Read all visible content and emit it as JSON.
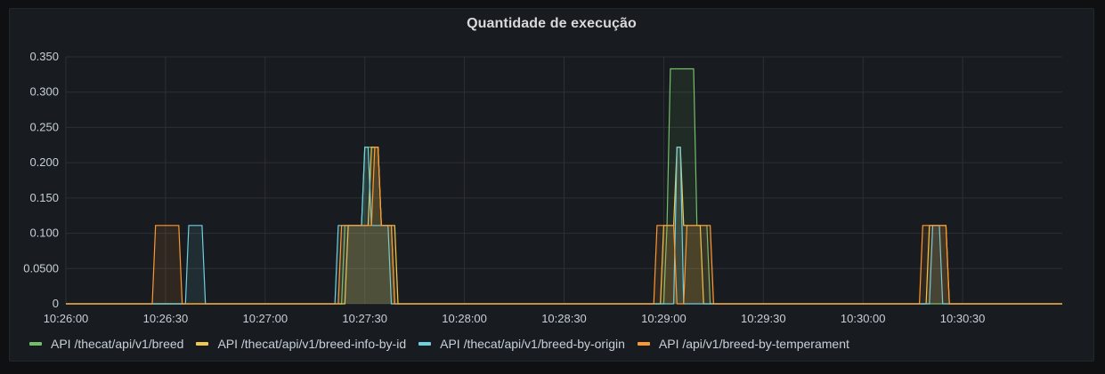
{
  "panel": {
    "title": "Quantidade de execução"
  },
  "chart_data": {
    "type": "area",
    "title": "Quantidade de execução",
    "xlabel": "",
    "ylabel": "",
    "y_ticks": [
      "0",
      "0.0500",
      "0.100",
      "0.150",
      "0.200",
      "0.250",
      "0.300",
      "0.350"
    ],
    "ylim": [
      0,
      0.35
    ],
    "x_ticks": [
      "10:26:00",
      "10:26:30",
      "10:27:00",
      "10:27:30",
      "10:28:00",
      "10:28:30",
      "10:29:00",
      "10:29:30",
      "10:30:00",
      "10:30:30"
    ],
    "xlim": [
      "10:26:00",
      "10:31:00"
    ],
    "grid": true,
    "legend_position": "bottom-left",
    "series": [
      {
        "name": "API /thecat/api/v1/breed",
        "color": "#73bf69",
        "points": [
          [
            "10:26:00",
            0
          ],
          [
            "10:27:23",
            0
          ],
          [
            "10:27:24",
            0.111
          ],
          [
            "10:27:29",
            0.111
          ],
          [
            "10:27:30",
            0.222
          ],
          [
            "10:27:34",
            0.222
          ],
          [
            "10:27:35",
            0.111
          ],
          [
            "10:27:38",
            0.111
          ],
          [
            "10:27:39",
            0
          ],
          [
            "10:29:00",
            0
          ],
          [
            "10:29:01",
            0.111
          ],
          [
            "10:29:02",
            0.333
          ],
          [
            "10:29:09",
            0.333
          ],
          [
            "10:29:10",
            0.111
          ],
          [
            "10:29:13",
            0.111
          ],
          [
            "10:29:14",
            0
          ],
          [
            "10:31:00",
            0
          ]
        ]
      },
      {
        "name": "API /thecat/api/v1/breed-info-by-id",
        "color": "#f2c94c",
        "points": [
          [
            "10:26:00",
            0
          ],
          [
            "10:27:24",
            0
          ],
          [
            "10:27:25",
            0.111
          ],
          [
            "10:27:31",
            0.111
          ],
          [
            "10:27:32",
            0.222
          ],
          [
            "10:27:34",
            0.222
          ],
          [
            "10:27:35",
            0.111
          ],
          [
            "10:27:39",
            0.111
          ],
          [
            "10:27:40",
            0
          ],
          [
            "10:28:59",
            0
          ],
          [
            "10:29:00",
            0.111
          ],
          [
            "10:29:03",
            0.111
          ],
          [
            "10:29:04",
            0.222
          ],
          [
            "10:29:05",
            0.222
          ],
          [
            "10:29:06",
            0.111
          ],
          [
            "10:29:11",
            0.111
          ],
          [
            "10:29:12",
            0
          ],
          [
            "10:30:19",
            0
          ],
          [
            "10:30:20",
            0.111
          ],
          [
            "10:30:25",
            0.111
          ],
          [
            "10:30:26",
            0
          ],
          [
            "10:31:00",
            0
          ]
        ]
      },
      {
        "name": "API /thecat/api/v1/breed-by-origin",
        "color": "#6ed0e0",
        "points": [
          [
            "10:26:00",
            0
          ],
          [
            "10:26:36",
            0
          ],
          [
            "10:26:37",
            0.111
          ],
          [
            "10:26:41",
            0.111
          ],
          [
            "10:26:42",
            0
          ],
          [
            "10:27:21",
            0
          ],
          [
            "10:27:22",
            0.111
          ],
          [
            "10:27:29",
            0.111
          ],
          [
            "10:27:30",
            0.222
          ],
          [
            "10:27:31",
            0.222
          ],
          [
            "10:27:32",
            0.111
          ],
          [
            "10:27:37",
            0.111
          ],
          [
            "10:27:38",
            0
          ],
          [
            "10:29:03",
            0
          ],
          [
            "10:29:04",
            0.222
          ],
          [
            "10:29:05",
            0.222
          ],
          [
            "10:29:06",
            0
          ],
          [
            "10:30:20",
            0
          ],
          [
            "10:30:21",
            0.111
          ],
          [
            "10:30:23",
            0.111
          ],
          [
            "10:30:24",
            0
          ],
          [
            "10:31:00",
            0
          ]
        ]
      },
      {
        "name": "API /api/v1/breed-by-temperament",
        "color": "#ff9830",
        "points": [
          [
            "10:26:00",
            0
          ],
          [
            "10:26:26",
            0
          ],
          [
            "10:26:27",
            0.111
          ],
          [
            "10:26:34",
            0.111
          ],
          [
            "10:26:35",
            0
          ],
          [
            "10:27:22",
            0
          ],
          [
            "10:27:23",
            0.111
          ],
          [
            "10:27:32",
            0.111
          ],
          [
            "10:27:33",
            0.222
          ],
          [
            "10:27:34",
            0.222
          ],
          [
            "10:27:35",
            0.111
          ],
          [
            "10:27:38",
            0.111
          ],
          [
            "10:27:39",
            0
          ],
          [
            "10:28:57",
            0
          ],
          [
            "10:28:58",
            0.111
          ],
          [
            "10:29:03",
            0.111
          ],
          [
            "10:29:04",
            0
          ],
          [
            "10:29:06",
            0
          ],
          [
            "10:29:07",
            0.111
          ],
          [
            "10:29:14",
            0.111
          ],
          [
            "10:29:15",
            0
          ],
          [
            "10:30:17",
            0
          ],
          [
            "10:30:18",
            0.111
          ],
          [
            "10:30:25",
            0.111
          ],
          [
            "10:30:26",
            0
          ],
          [
            "10:31:00",
            0
          ]
        ]
      }
    ]
  }
}
